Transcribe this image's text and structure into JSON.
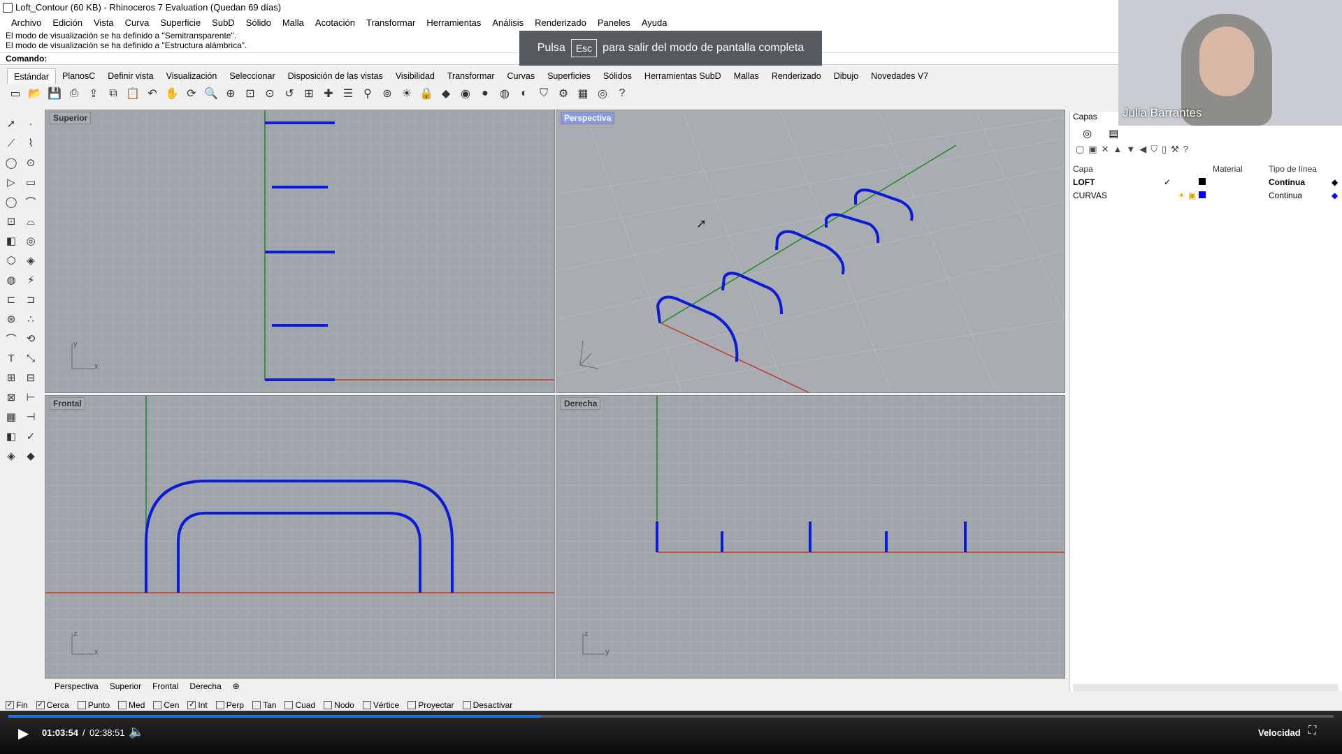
{
  "window": {
    "title": "Loft_Contour (60 KB) - Rhinoceros 7 Evaluation (Quedan 69 días)"
  },
  "menu": [
    "Archivo",
    "Edición",
    "Vista",
    "Curva",
    "Superficie",
    "SubD",
    "Sólido",
    "Malla",
    "Acotación",
    "Transformar",
    "Herramientas",
    "Análisis",
    "Renderizado",
    "Paneles",
    "Ayuda"
  ],
  "command": {
    "history": [
      "El modo de visualización se ha definido a \"Semitransparente\".",
      "El modo de visualización se ha definido a \"Estructura alámbrica\"."
    ],
    "prompt": "Comando:"
  },
  "fullscreen_notice": {
    "before": "Pulsa",
    "key": "Esc",
    "after": "para salir del modo de pantalla completa"
  },
  "tabs": [
    "Estándar",
    "PlanosC",
    "Definir vista",
    "Visualización",
    "Seleccionar",
    "Disposición de las vistas",
    "Visibilidad",
    "Transformar",
    "Curvas",
    "Superficies",
    "Sólidos",
    "Herramientas SubD",
    "Mallas",
    "Renderizado",
    "Dibujo",
    "Novedades V7"
  ],
  "toolbar_icons": [
    "new-file-icon",
    "open-icon",
    "save-icon",
    "print-icon",
    "import-icon",
    "copy-icon",
    "paste-icon",
    "undo-icon",
    "pan-icon",
    "rotate-icon",
    "zoom-icon",
    "zoom-window-icon",
    "zoom-extents-icon",
    "zoom-selected-icon",
    "undo-view-icon",
    "four-viewports-icon",
    "cplane-icon",
    "properties-icon",
    "snap-icon",
    "osnap-icon",
    "light-icon",
    "lock-icon",
    "layer-icon",
    "color-icon",
    "shade-icon",
    "rendered-icon",
    "material-icon",
    "filter-icon",
    "options-icon",
    "grid-icon",
    "globe-icon",
    "help-icon"
  ],
  "viewports": {
    "top": {
      "label": "Superior"
    },
    "perspective": {
      "label": "Perspectiva"
    },
    "front": {
      "label": "Frontal"
    },
    "right": {
      "label": "Derecha"
    }
  },
  "viewport_tabs": [
    "Perspectiva",
    "Superior",
    "Frontal",
    "Derecha"
  ],
  "layers_panel": {
    "title": "Capas",
    "columns": [
      "Capa",
      "Material",
      "Tipo de línea"
    ],
    "rows": [
      {
        "name": "LOFT",
        "linetype": "Continua",
        "color": "#000000",
        "current": true
      },
      {
        "name": "CURVAS",
        "linetype": "Continua",
        "color": "#0000ff",
        "current": false
      }
    ]
  },
  "osnaps": [
    {
      "label": "Fin",
      "checked": true
    },
    {
      "label": "Cerca",
      "checked": true
    },
    {
      "label": "Punto",
      "checked": false
    },
    {
      "label": "Med",
      "checked": false
    },
    {
      "label": "Cen",
      "checked": false
    },
    {
      "label": "Int",
      "checked": true
    },
    {
      "label": "Perp",
      "checked": false
    },
    {
      "label": "Tan",
      "checked": false
    },
    {
      "label": "Cuad",
      "checked": false
    },
    {
      "label": "Nodo",
      "checked": false
    },
    {
      "label": "Vértice",
      "checked": false
    },
    {
      "label": "Proyectar",
      "checked": false
    },
    {
      "label": "Desactivar",
      "checked": false
    }
  ],
  "player": {
    "current": "01:03:54",
    "total": "02:38:51",
    "speed_label": "Velocidad",
    "progress": 0.402
  },
  "webcam": {
    "name": "Julia Barrantes"
  },
  "colors": {
    "curve": "#0b1bd6",
    "x_axis": "#c0392b",
    "y_axis": "#1e8a1e",
    "viewport_bg": "#9fa5ab"
  }
}
